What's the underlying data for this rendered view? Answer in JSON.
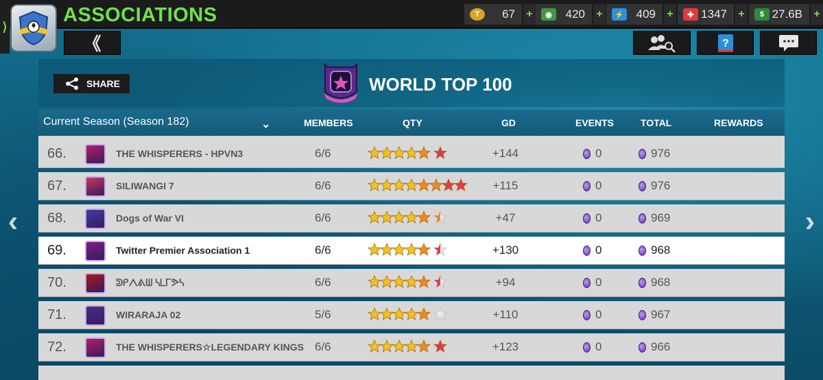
{
  "app": {
    "title": "ASSOCIATIONS",
    "side_tab_glyph": "⟩",
    "back_glyph": "《"
  },
  "resources": [
    {
      "name": "coin-icon",
      "value": "67",
      "color": "#d8a52b",
      "glyph": "T"
    },
    {
      "name": "cash-icon",
      "value": "420",
      "color": "#3f9a3f",
      "glyph": "◉"
    },
    {
      "name": "energy-icon",
      "value": "409",
      "color": "#2b8fe0",
      "glyph": "⚡"
    },
    {
      "name": "health-icon",
      "value": "1347",
      "color": "#e23a3a",
      "glyph": "✚"
    },
    {
      "name": "money-icon",
      "value": "27.6B",
      "color": "#2c8a3a",
      "glyph": "$"
    }
  ],
  "resource_plus": "+",
  "panel": {
    "share_label": "SHARE",
    "heading": "WORLD TOP 100",
    "season_selector": "Current Season (Season 182)",
    "columns": {
      "members": "MEMBERS",
      "qty": "QTY",
      "gd": "GD",
      "events": "EVENTS",
      "total": "TOTAL",
      "rewards": "REWARDS"
    }
  },
  "colors": {
    "title_green": "#6fe24a",
    "row_bg": "#d8d8d8",
    "row_highlight": "#ffffff",
    "star_gold": "#f2c31c",
    "star_orange": "#f08a1e",
    "star_red": "#e23a4a",
    "star_gray": "#cfcfcf"
  },
  "rows": [
    {
      "rank": "66.",
      "name": "THE WHISPERERS - HPVN3",
      "members": "6/6",
      "stars": [
        "g",
        "g",
        "g",
        "g",
        "o",
        "r"
      ],
      "gd": "+144",
      "events": "0",
      "total": "976",
      "badge": "#b0226a",
      "highlight": false
    },
    {
      "rank": "67.",
      "name": "SILIWANGI 7",
      "members": "6/6",
      "stars": [
        "g",
        "g",
        "g",
        "g",
        "o",
        "o",
        "r",
        "r"
      ],
      "gd": "+115",
      "events": "0",
      "total": "976",
      "badge": "#c23a5a",
      "highlight": false
    },
    {
      "rank": "68.",
      "name": "Dogs of War VI",
      "members": "6/6",
      "stars": [
        "g",
        "g",
        "g",
        "g",
        "o",
        "h"
      ],
      "gd": "+47",
      "events": "0",
      "total": "969",
      "badge": "#3b3fa6",
      "highlight": false
    },
    {
      "rank": "69.",
      "name": "Twitter Premier Association 1",
      "members": "6/6",
      "stars": [
        "g",
        "g",
        "g",
        "g",
        "o",
        "rh"
      ],
      "gd": "+130",
      "events": "0",
      "total": "968",
      "badge": "#7a1f8a",
      "highlight": true
    },
    {
      "rank": "70.",
      "name": "ᕲᑭᐱᕕᗯ ᓴᒪᒥᕗᓴ",
      "members": "6/6",
      "stars": [
        "g",
        "g",
        "g",
        "g",
        "o",
        "rh"
      ],
      "gd": "+94",
      "events": "0",
      "total": "968",
      "badge": "#a31a1a",
      "highlight": false
    },
    {
      "rank": "71.",
      "name": "WIRARAJA 02",
      "members": "5/6",
      "stars": [
        "g",
        "g",
        "g",
        "g",
        "o",
        "e"
      ],
      "gd": "+110",
      "events": "0",
      "total": "967",
      "badge": "#4a2d8a",
      "highlight": false
    },
    {
      "rank": "72.",
      "name": "THE WHISPERERS☆LEGENDARY KINGS",
      "members": "6/6",
      "stars": [
        "g",
        "g",
        "g",
        "g",
        "o",
        "r"
      ],
      "gd": "+123",
      "events": "0",
      "total": "966",
      "badge": "#b0226a",
      "highlight": false
    }
  ],
  "nav": {
    "left_arrow": "‹",
    "right_arrow": "›"
  }
}
